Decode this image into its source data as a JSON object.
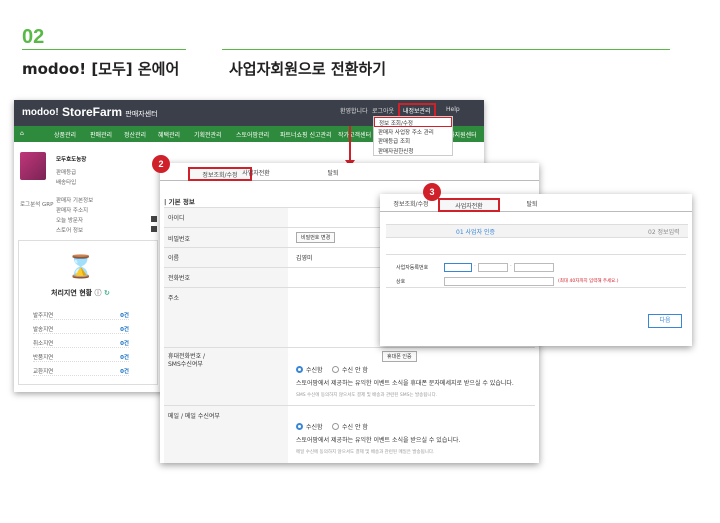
{
  "step_number": "02",
  "left_title": "modoo! [모두] 온에어",
  "right_title": "사업자회원으로 전환하기",
  "bg": {
    "logo": "modoo!",
    "brand": "StoreFarm",
    "brand_sub": "판매자센터",
    "top_menu": [
      "환영합니다",
      "로그아웃",
      "내정보관리",
      "Help"
    ],
    "nav_items": [
      "상품관리",
      "판매관리",
      "정산관리",
      "혜택관리",
      "기획전관리",
      "스토어팜관리",
      "파트너쇼핑 신고관리",
      "작가고객센터",
      "판매자지원센터"
    ],
    "dropdown_items": [
      "정보 조회/수정",
      "판매자 사업장 주소 관리",
      "판매등급 조회",
      "판매자권한신청"
    ],
    "profile_name": "모두호도농장",
    "sidebar_lines": [
      "판매등급",
      "배송타입",
      "판매자 기본정보",
      "판매자 주소지",
      "오늘 방문자",
      "스토어 정보"
    ],
    "profile_footer": "로그분석 GRP",
    "delay_title": "처리지연 현황",
    "delay_rows": [
      {
        "label": "발주지연",
        "count": "0건"
      },
      {
        "label": "발송지연",
        "count": "0건"
      },
      {
        "label": "취소지연",
        "count": "0건"
      },
      {
        "label": "반품지연",
        "count": "0건"
      },
      {
        "label": "교환지연",
        "count": "0건"
      }
    ]
  },
  "form": {
    "tabs": [
      "정보조회/수정",
      "사업자전환",
      "탈퇴"
    ],
    "section": "기본 정보",
    "rows": [
      {
        "label": "아이디",
        "value": ""
      },
      {
        "label": "비밀번호",
        "value": "비밀번호 변경"
      },
      {
        "label": "이름",
        "value": "김영미"
      },
      {
        "label": "전화번호",
        "value": ""
      },
      {
        "label": "주소",
        "value": ""
      }
    ],
    "phone_label": "휴대전화번호 /\nSMS수신여부",
    "phone_btn": "휴대폰 인증",
    "radio_yes": "수신함",
    "radio_no": "수신 안 함",
    "sms_desc": "스토어팜에서 제공하는 유익한 이벤트 소식을 휴대폰 문자메세지로 받으실 수 있습니다.",
    "sms_note": "SMS 수신에 동의하지 않으셔도 결제 및 배송과 관련된 SMS는 발송됩니다.",
    "email_label": "메일 / 메일 수신여부",
    "email_desc": "스토어팜에서 제공하는 유익한 이벤트 소식을 받으실 수 있습니다.",
    "email_note": "메일 수신에 동의하지 않으셔도 결제 및 배송과 관련된 메일은 발송됩니다."
  },
  "convert": {
    "tabs": [
      "정보조회/수정",
      "사업자전환",
      "탈퇴"
    ],
    "step1": "01 사업자 인증",
    "step2": "02 정보입력",
    "biz_no_label": "사업자등록번호",
    "company_label": "상호",
    "company_hint": "(최대 40자까지 입력해 주세요.)",
    "next_btn": "다음"
  },
  "badges": [
    "2",
    "3"
  ],
  "accent_color": "#d0202a",
  "title_green": "#58b947"
}
